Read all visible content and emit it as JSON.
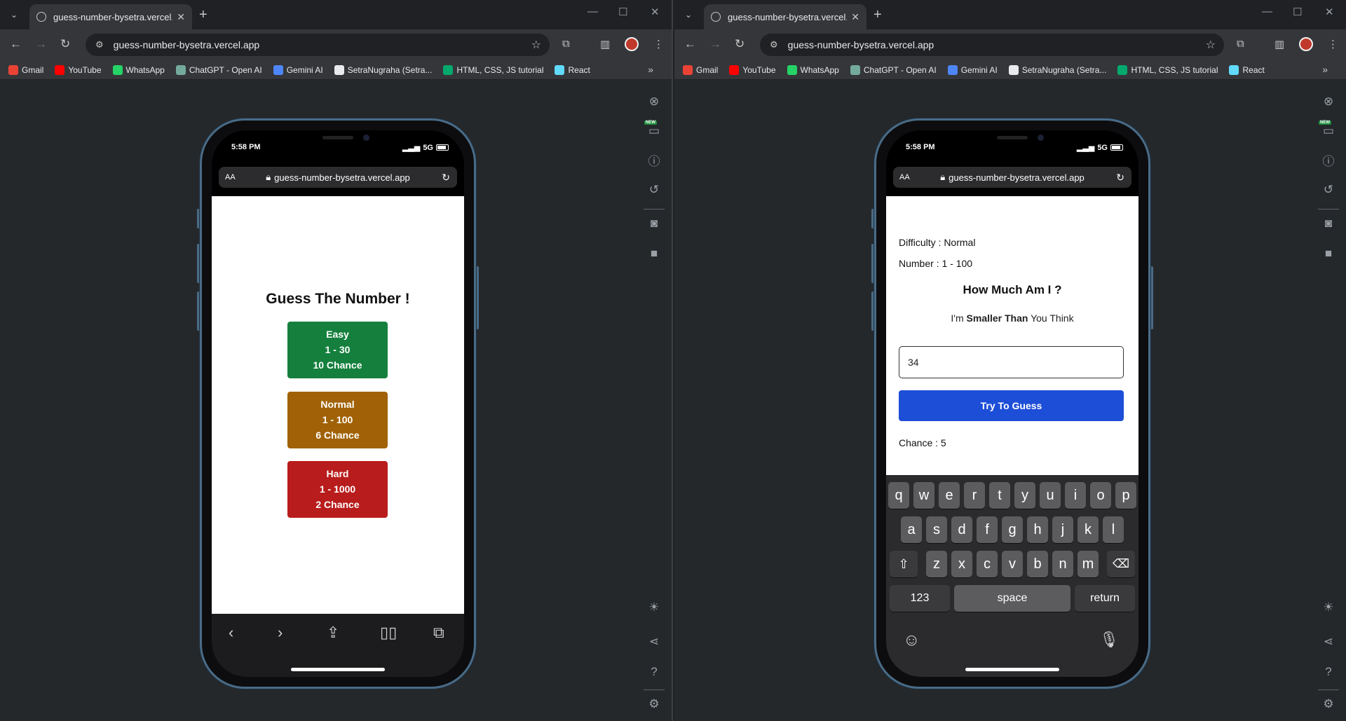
{
  "browser": {
    "tab_title": "guess-number-bysetra.vercel.app",
    "new_tab": "+",
    "url": "guess-number-bysetra.vercel.app",
    "bookmarks": [
      {
        "label": "Gmail",
        "color": "#ea4335"
      },
      {
        "label": "YouTube",
        "color": "#ff0000"
      },
      {
        "label": "WhatsApp",
        "color": "#25d366"
      },
      {
        "label": "ChatGPT - Open AI",
        "color": "#74aa9c"
      },
      {
        "label": "Gemini AI",
        "color": "#4e86f7"
      },
      {
        "label": "SetraNugraha (Setra...",
        "color": "#e8eaed"
      },
      {
        "label": "HTML, CSS, JS tutorial",
        "color": "#04aa6d"
      },
      {
        "label": "React",
        "color": "#61dafb"
      }
    ],
    "bookmarks_more": "»"
  },
  "phone": {
    "time": "5:58 PM",
    "network": "5G",
    "aa": "AA",
    "url": "guess-number-bysetra.vercel.app"
  },
  "home": {
    "title": "Guess The Number !",
    "buttons": [
      {
        "name": "Easy",
        "range": "1 - 30",
        "chance": "10 Chance",
        "color": "#15803d"
      },
      {
        "name": "Normal",
        "range": "1 - 100",
        "chance": "6 Chance",
        "color": "#a16207"
      },
      {
        "name": "Hard",
        "range": "1 - 1000",
        "chance": "2 Chance",
        "color": "#b91c1c"
      }
    ]
  },
  "game": {
    "difficulty": "Difficulty : Normal",
    "number": "Number : 1 - 100",
    "title": "How Much Am I ?",
    "hint_pre": "I'm ",
    "hint_bold": "Smaller Than",
    "hint_post": " You Think",
    "input_value": "34",
    "button": "Try To Guess",
    "chance": "Chance : 5"
  },
  "keyboard": {
    "row1": [
      "q",
      "w",
      "e",
      "r",
      "t",
      "y",
      "u",
      "i",
      "o",
      "p"
    ],
    "row2": [
      "a",
      "s",
      "d",
      "f",
      "g",
      "h",
      "j",
      "k",
      "l"
    ],
    "row3": [
      "z",
      "x",
      "c",
      "v",
      "b",
      "n",
      "m"
    ],
    "num": "123",
    "space": "space",
    "return": "return"
  },
  "colors": {
    "accent_button": "#1d4ed8"
  }
}
